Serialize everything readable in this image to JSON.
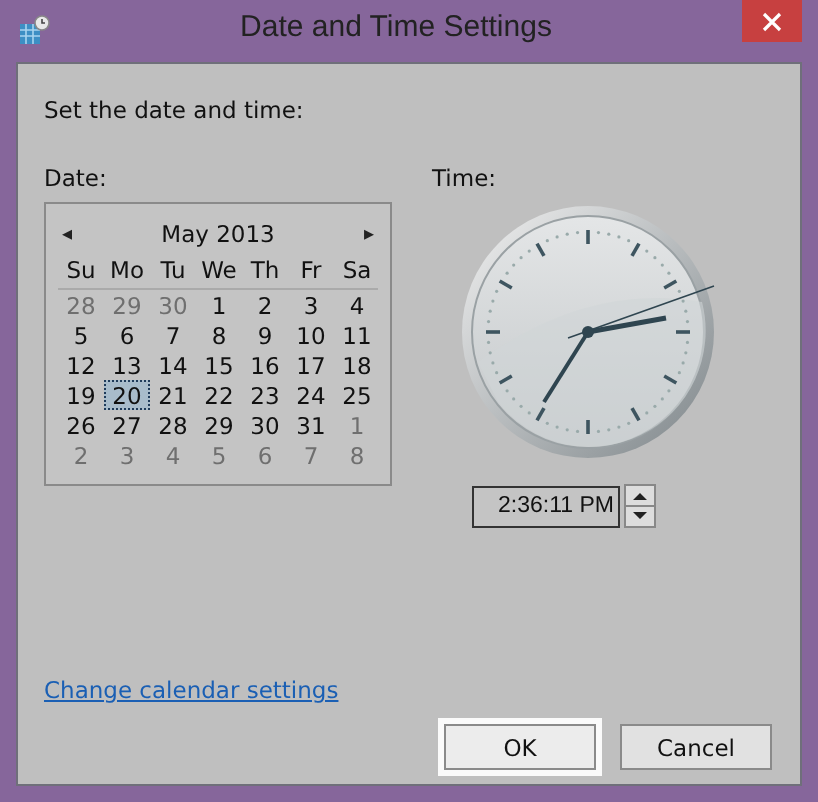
{
  "window": {
    "title": "Date and Time Settings"
  },
  "instruction": "Set the date and time:",
  "date": {
    "label": "Date:",
    "month": "May 2013",
    "prev": "◂",
    "next": "▸",
    "weekdays": [
      "Su",
      "Mo",
      "Tu",
      "We",
      "Th",
      "Fr",
      "Sa"
    ],
    "weeks": [
      [
        {
          "day": "28",
          "outside_month": true,
          "selected": false
        },
        {
          "day": "29",
          "outside_month": true,
          "selected": false
        },
        {
          "day": "30",
          "outside_month": true,
          "selected": false
        },
        {
          "day": "1",
          "outside_month": false,
          "selected": false
        },
        {
          "day": "2",
          "outside_month": false,
          "selected": false
        },
        {
          "day": "3",
          "outside_month": false,
          "selected": false
        },
        {
          "day": "4",
          "outside_month": false,
          "selected": false
        }
      ],
      [
        {
          "day": "5",
          "outside_month": false,
          "selected": false
        },
        {
          "day": "6",
          "outside_month": false,
          "selected": false
        },
        {
          "day": "7",
          "outside_month": false,
          "selected": false
        },
        {
          "day": "8",
          "outside_month": false,
          "selected": false
        },
        {
          "day": "9",
          "outside_month": false,
          "selected": false
        },
        {
          "day": "10",
          "outside_month": false,
          "selected": false
        },
        {
          "day": "11",
          "outside_month": false,
          "selected": false
        }
      ],
      [
        {
          "day": "12",
          "outside_month": false,
          "selected": false
        },
        {
          "day": "13",
          "outside_month": false,
          "selected": false
        },
        {
          "day": "14",
          "outside_month": false,
          "selected": false
        },
        {
          "day": "15",
          "outside_month": false,
          "selected": false
        },
        {
          "day": "16",
          "outside_month": false,
          "selected": false
        },
        {
          "day": "17",
          "outside_month": false,
          "selected": false
        },
        {
          "day": "18",
          "outside_month": false,
          "selected": false
        }
      ],
      [
        {
          "day": "19",
          "outside_month": false,
          "selected": false
        },
        {
          "day": "20",
          "outside_month": false,
          "selected": true
        },
        {
          "day": "21",
          "outside_month": false,
          "selected": false
        },
        {
          "day": "22",
          "outside_month": false,
          "selected": false
        },
        {
          "day": "23",
          "outside_month": false,
          "selected": false
        },
        {
          "day": "24",
          "outside_month": false,
          "selected": false
        },
        {
          "day": "25",
          "outside_month": false,
          "selected": false
        }
      ],
      [
        {
          "day": "26",
          "outside_month": false,
          "selected": false
        },
        {
          "day": "27",
          "outside_month": false,
          "selected": false
        },
        {
          "day": "28",
          "outside_month": false,
          "selected": false
        },
        {
          "day": "29",
          "outside_month": false,
          "selected": false
        },
        {
          "day": "30",
          "outside_month": false,
          "selected": false
        },
        {
          "day": "31",
          "outside_month": false,
          "selected": false
        },
        {
          "day": "1",
          "outside_month": true,
          "selected": false
        }
      ],
      [
        {
          "day": "2",
          "outside_month": true,
          "selected": false
        },
        {
          "day": "3",
          "outside_month": true,
          "selected": false
        },
        {
          "day": "4",
          "outside_month": true,
          "selected": false
        },
        {
          "day": "5",
          "outside_month": true,
          "selected": false
        },
        {
          "day": "6",
          "outside_month": true,
          "selected": false
        },
        {
          "day": "7",
          "outside_month": true,
          "selected": false
        },
        {
          "day": "8",
          "outside_month": true,
          "selected": false
        }
      ]
    ]
  },
  "time": {
    "label": "Time:",
    "value": "2:36:11 PM"
  },
  "link": "Change calendar settings",
  "buttons": [
    {
      "label": "OK",
      "focused": true
    },
    {
      "label": "Cancel",
      "focused": false
    }
  ]
}
